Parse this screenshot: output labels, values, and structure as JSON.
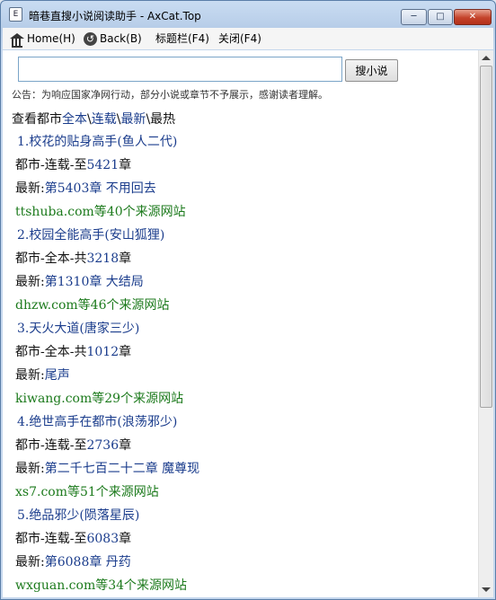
{
  "window": {
    "title": "暗巷直搜小说阅读助手 - AxCat.Top",
    "icon_label": "E"
  },
  "toolbar": {
    "home_label": "Home(H)",
    "back_label": "Back(B)",
    "titlebar_label": "标题栏(F4)",
    "close_label": "关闭(F4)"
  },
  "search": {
    "value": "",
    "placeholder": "",
    "button_label": "搜小说"
  },
  "notice": "公告：为响应国家净网行动，部分小说或章节不予展示，感谢读者理解。",
  "filter": {
    "prefix": "查看都市",
    "options": [
      "全本",
      "连载",
      "最新"
    ],
    "separator": "\\",
    "current": "最热"
  },
  "results": [
    {
      "index": "1.",
      "title": "校花的贴身高手",
      "author": "(鱼人二代)",
      "category": "都市",
      "status_label": "-连载-至",
      "chapter_count": "5421",
      "chapter_suffix": "章",
      "latest_prefix": "最新:",
      "latest_chapter": "第5403章  不用回去",
      "source": "ttshuba.com",
      "source_suffix": "等40个来源网站"
    },
    {
      "index": "2.",
      "title": "校园全能高手",
      "author": "(安山狐狸)",
      "category": "都市",
      "status_label": "-全本-共",
      "chapter_count": "3218",
      "chapter_suffix": "章",
      "latest_prefix": "最新:",
      "latest_chapter": "第1310章  大结局",
      "source": "dhzw.com",
      "source_suffix": "等46个来源网站"
    },
    {
      "index": "3.",
      "title": "天火大道",
      "author": "(唐家三少)",
      "category": "都市",
      "status_label": "-全本-共",
      "chapter_count": "1012",
      "chapter_suffix": "章",
      "latest_prefix": "最新:",
      "latest_chapter": "尾声",
      "source": "kiwang.com",
      "source_suffix": "等29个来源网站"
    },
    {
      "index": "4.",
      "title": "绝世高手在都市",
      "author": "(浪荡邪少)",
      "category": "都市",
      "status_label": "-连载-至",
      "chapter_count": "2736",
      "chapter_suffix": "章",
      "latest_prefix": "最新:",
      "latest_chapter": "第二千七百二十二章  魔尊现",
      "source": "xs7.com",
      "source_suffix": "等51个来源网站"
    },
    {
      "index": "5.",
      "title": "绝品邪少",
      "author": "(陨落星辰)",
      "category": "都市",
      "status_label": "-连载-至",
      "chapter_count": "6083",
      "chapter_suffix": "章",
      "latest_prefix": "最新:",
      "latest_chapter": "第6088章  丹药",
      "source": "wxguan.com",
      "source_suffix": "等34个来源网站"
    }
  ]
}
